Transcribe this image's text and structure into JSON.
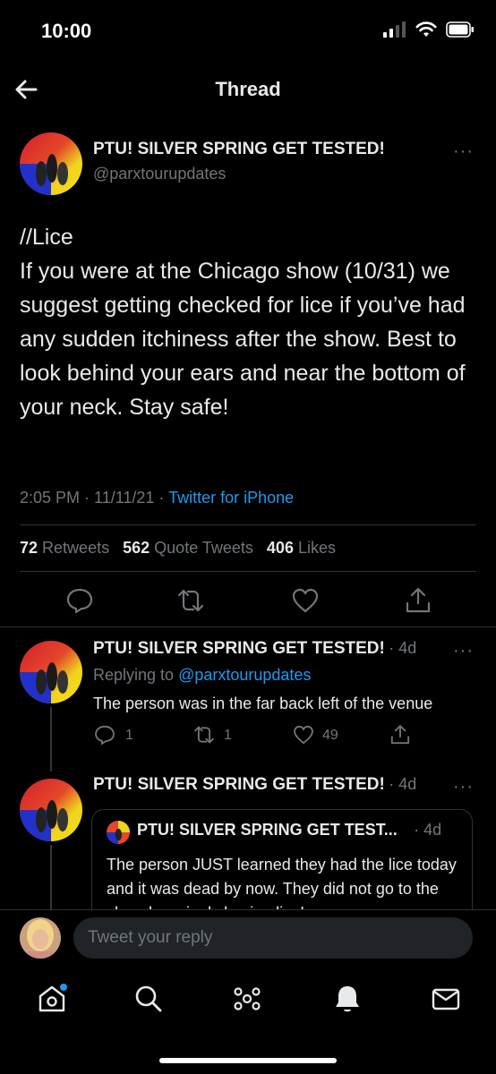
{
  "status_bar": {
    "time": "10:00"
  },
  "nav": {
    "title": "Thread"
  },
  "main_tweet": {
    "author_name": "PTU! SILVER SPRING GET TESTED!",
    "handle": "@parxtourupdates",
    "text": "//Lice\nIf you were at the Chicago show (10/31) we suggest getting checked for lice if you’ve had any sudden itchiness after the show. Best to look behind your ears and near the bottom of your neck. Stay safe!",
    "time": "2:05 PM · 11/11/21 · ",
    "source": "Twitter for iPhone",
    "retweets_count": "72",
    "retweets_label": "Retweets",
    "quotes_count": "562",
    "quotes_label": "Quote Tweets",
    "likes_count": "406",
    "likes_label": "Likes",
    "more": "···"
  },
  "reply1": {
    "author_name": "PTU! SILVER SPRING GET TESTED!",
    "age": "· 4d",
    "replying_prefix": "Replying to ",
    "replying_handle": "@parxtourupdates",
    "text": "The person was in the far back left of the venue",
    "reply_count": "1",
    "retweet_count": "1",
    "like_count": "49",
    "more": "···"
  },
  "reply2": {
    "author_name": "PTU! SILVER SPRING GET TESTED!",
    "age": "· 4d",
    "more": "···",
    "quote": {
      "author_name": "PTU! SILVER SPRING GET TEST...",
      "age": "· 4d",
      "text": "The person JUST learned they had the lice today and it was dead by now. They did not go to the show knowingly having lice!"
    }
  },
  "composer": {
    "placeholder": "Tweet your reply"
  },
  "colors": {
    "accent": "#1d9bf0",
    "muted": "#71767b",
    "background": "#000000"
  },
  "tabs": [
    "home-icon",
    "search-icon",
    "spaces-icon",
    "notifications-icon",
    "messages-icon"
  ]
}
